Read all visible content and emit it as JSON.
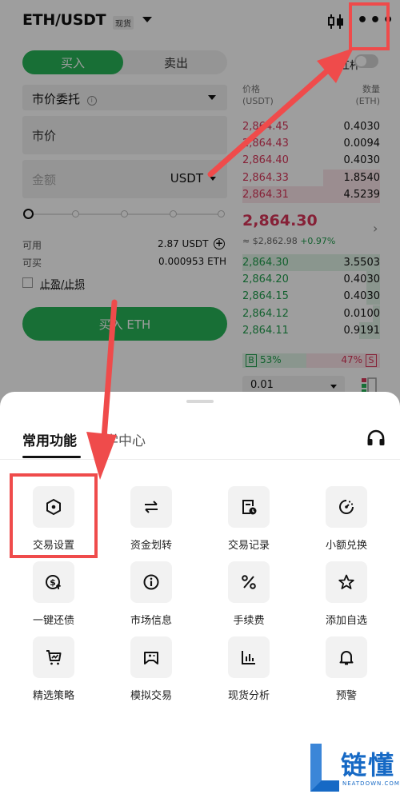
{
  "header": {
    "pair": "ETH/USDT",
    "market_tag": "现货"
  },
  "order_form": {
    "tabs": {
      "buy": "买入",
      "sell": "卖出"
    },
    "order_type": "市价委托",
    "price_field": "市价",
    "amount_placeholder": "金额",
    "amount_unit": "USDT",
    "slider_value_percent": 0,
    "available_label": "可用",
    "available_value": "2.87 USDT",
    "buyable_label": "可买",
    "buyable_value": "0.000953 ETH",
    "tpsl_label": "止盈/止损",
    "buy_button": "买入 ETH"
  },
  "orderbook": {
    "leverage_label": "杠杆",
    "price_header": "价格",
    "price_unit": "(USDT)",
    "qty_header": "数量",
    "qty_unit": "(ETH)",
    "asks": [
      {
        "price": "2,864.45",
        "qty": "0.4030",
        "depth": 0.0
      },
      {
        "price": "2,864.43",
        "qty": "0.0094",
        "depth": 0.0
      },
      {
        "price": "2,864.40",
        "qty": "0.4030",
        "depth": 0.0
      },
      {
        "price": "2,864.33",
        "qty": "1.8540",
        "depth": 0.41
      },
      {
        "price": "2,864.31",
        "qty": "4.5239",
        "depth": 1.0
      }
    ],
    "last_price": "2,864.30",
    "last_price_usd": "≈ $2,862.98",
    "change": "+0.97%",
    "bids": [
      {
        "price": "2,864.30",
        "qty": "3.5503",
        "depth": 1.0
      },
      {
        "price": "2,864.20",
        "qty": "0.4030",
        "depth": 0.1
      },
      {
        "price": "2,864.15",
        "qty": "0.4030",
        "depth": 0.1
      },
      {
        "price": "2,864.12",
        "qty": "0.0100",
        "depth": 0.05
      },
      {
        "price": "2,864.11",
        "qty": "0.9191",
        "depth": 0.15
      }
    ],
    "buy_tag": "B",
    "buy_ratio": "53%",
    "sell_ratio": "47%",
    "sell_tag": "S",
    "precision": "0.01"
  },
  "sheet": {
    "tabs": [
      "常用功能",
      "教学中心"
    ],
    "features": [
      {
        "label": "交易设置",
        "icon": "hexagon-settings-icon"
      },
      {
        "label": "资金划转",
        "icon": "transfer-arrows-icon"
      },
      {
        "label": "交易记录",
        "icon": "record-clock-icon"
      },
      {
        "label": "小额兑换",
        "icon": "small-exchange-icon"
      },
      {
        "label": "一键还债",
        "icon": "repay-coin-icon"
      },
      {
        "label": "市场信息",
        "icon": "info-circle-icon"
      },
      {
        "label": "手续费",
        "icon": "percent-icon"
      },
      {
        "label": "添加自选",
        "icon": "star-icon"
      },
      {
        "label": "精选策略",
        "icon": "strategy-cart-icon"
      },
      {
        "label": "模拟交易",
        "icon": "demo-trade-icon"
      },
      {
        "label": "现货分析",
        "icon": "bar-analysis-icon"
      },
      {
        "label": "预警",
        "icon": "bell-icon"
      }
    ]
  },
  "watermark": {
    "brand": "链懂",
    "domain": "NEATDOWN.COM"
  },
  "colors": {
    "green": "#27b457",
    "red": "#d9365a",
    "annotation": "#ef4b4b",
    "brand": "#1669c5"
  }
}
